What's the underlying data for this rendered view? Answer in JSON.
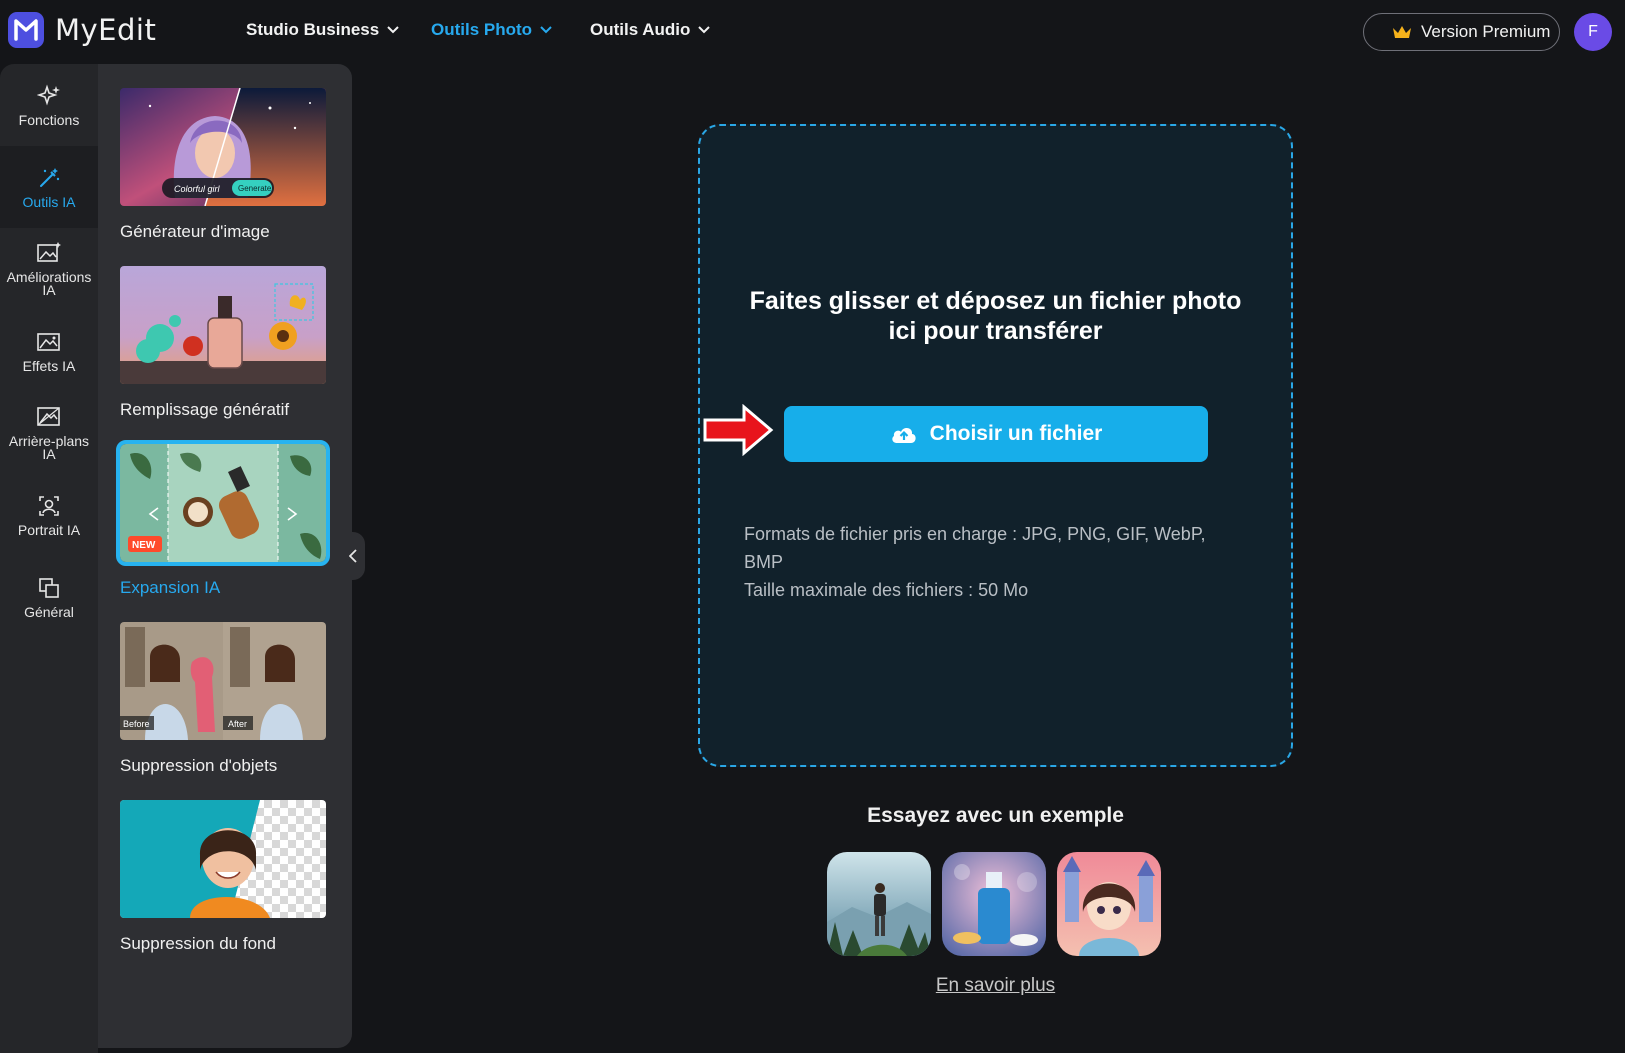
{
  "app": {
    "name": "MyEdit"
  },
  "nav": [
    {
      "label": "Studio Business"
    },
    {
      "label": "Outils Photo"
    },
    {
      "label": "Outils Audio"
    }
  ],
  "header": {
    "premium_label": "Version Premium",
    "avatar_initial": "F"
  },
  "rail": [
    {
      "label1": "Fonctions",
      "label2": ""
    },
    {
      "label1": "Outils IA",
      "label2": ""
    },
    {
      "label1": "Améliorations",
      "label2": "IA"
    },
    {
      "label1": "Effets IA",
      "label2": ""
    },
    {
      "label1": "Arrière-plans",
      "label2": "IA"
    },
    {
      "label1": "Portrait IA",
      "label2": ""
    },
    {
      "label1": "Général",
      "label2": ""
    }
  ],
  "tools": [
    {
      "label": "Générateur d'image",
      "thumb_text1": "Colorful girl",
      "thumb_text2": "Generate"
    },
    {
      "label": "Remplissage génératif"
    },
    {
      "label": "Expansion IA",
      "badge": "NEW"
    },
    {
      "label": "Suppression d'objets",
      "thumb_text1": "Before",
      "thumb_text2": "After"
    },
    {
      "label": "Suppression du fond"
    }
  ],
  "dropzone": {
    "title_line1": "Faites glisser et déposez un fichier photo",
    "title_line2": "ici pour transférer",
    "button_label": "Choisir un fichier",
    "formats_line1": "Formats de fichier pris en charge : JPG, PNG, GIF, WebP,",
    "formats_line2": "BMP",
    "max_size": "Taille maximale des fichiers : 50 Mo"
  },
  "examples": {
    "title": "Essayez avec un exemple",
    "learn_more": "En savoir plus"
  },
  "colors": {
    "accent": "#17aeea",
    "brand": "#4d4fe0",
    "avatar": "#6a4be6",
    "badge": "#ff4a2a"
  }
}
